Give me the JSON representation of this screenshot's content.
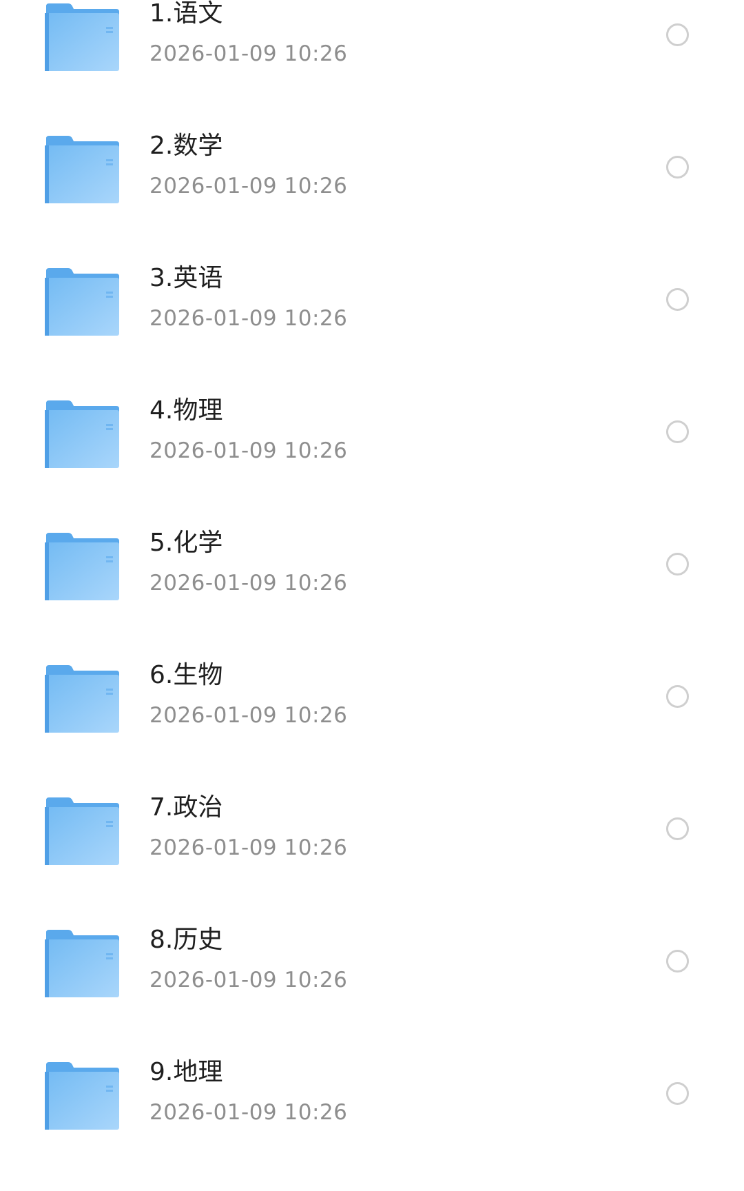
{
  "file_list": {
    "items": [
      {
        "name": "1.语文",
        "modified": "2026-01-09 10:26",
        "icon": "folder-icon"
      },
      {
        "name": "2.数学",
        "modified": "2026-01-09 10:26",
        "icon": "folder-icon"
      },
      {
        "name": "3.英语",
        "modified": "2026-01-09 10:26",
        "icon": "folder-icon"
      },
      {
        "name": "4.物理",
        "modified": "2026-01-09 10:26",
        "icon": "folder-icon"
      },
      {
        "name": "5.化学",
        "modified": "2026-01-09 10:26",
        "icon": "folder-icon"
      },
      {
        "name": "6.生物",
        "modified": "2026-01-09 10:26",
        "icon": "folder-icon"
      },
      {
        "name": "7.政治",
        "modified": "2026-01-09 10:26",
        "icon": "folder-icon"
      },
      {
        "name": "8.历史",
        "modified": "2026-01-09 10:26",
        "icon": "folder-icon"
      },
      {
        "name": "9.地理",
        "modified": "2026-01-09 10:26",
        "icon": "folder-icon"
      }
    ]
  },
  "colors": {
    "folder_blue": "#6cb6f2",
    "folder_tab": "#5aa9ec",
    "name_text": "#1f1f1f",
    "date_text": "#8e8e8e",
    "radio_border": "#cfcfcf"
  }
}
